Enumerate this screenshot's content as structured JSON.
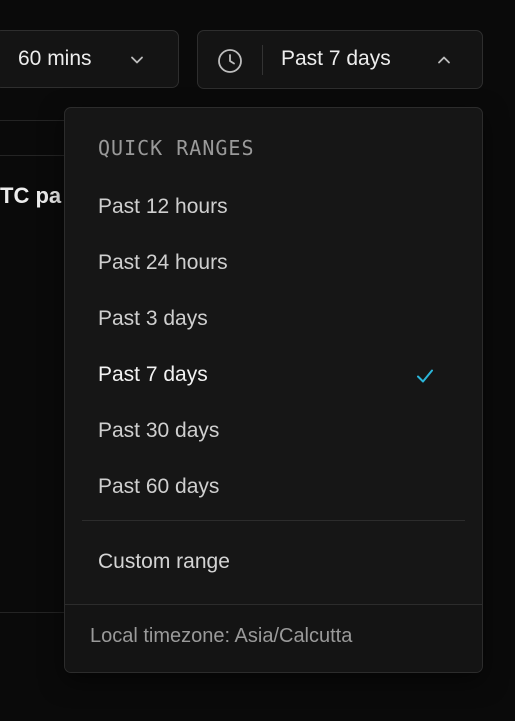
{
  "controls": {
    "interval_label": "60 mins",
    "range_label": "Past 7 days"
  },
  "background": {
    "heading_fragment": "TC pa"
  },
  "dropdown": {
    "section_title": "QUICK RANGES",
    "options": [
      {
        "label": "Past 12 hours",
        "selected": false
      },
      {
        "label": "Past 24 hours",
        "selected": false
      },
      {
        "label": "Past 3 days",
        "selected": false
      },
      {
        "label": "Past 7 days",
        "selected": true
      },
      {
        "label": "Past 30 days",
        "selected": false
      },
      {
        "label": "Past 60 days",
        "selected": false
      }
    ],
    "custom_range_label": "Custom range",
    "timezone_text": "Local timezone: Asia/Calcutta"
  },
  "colors": {
    "check_accent": "#2bb6d9",
    "background": "#0a0a0a",
    "panel": "#161616"
  }
}
